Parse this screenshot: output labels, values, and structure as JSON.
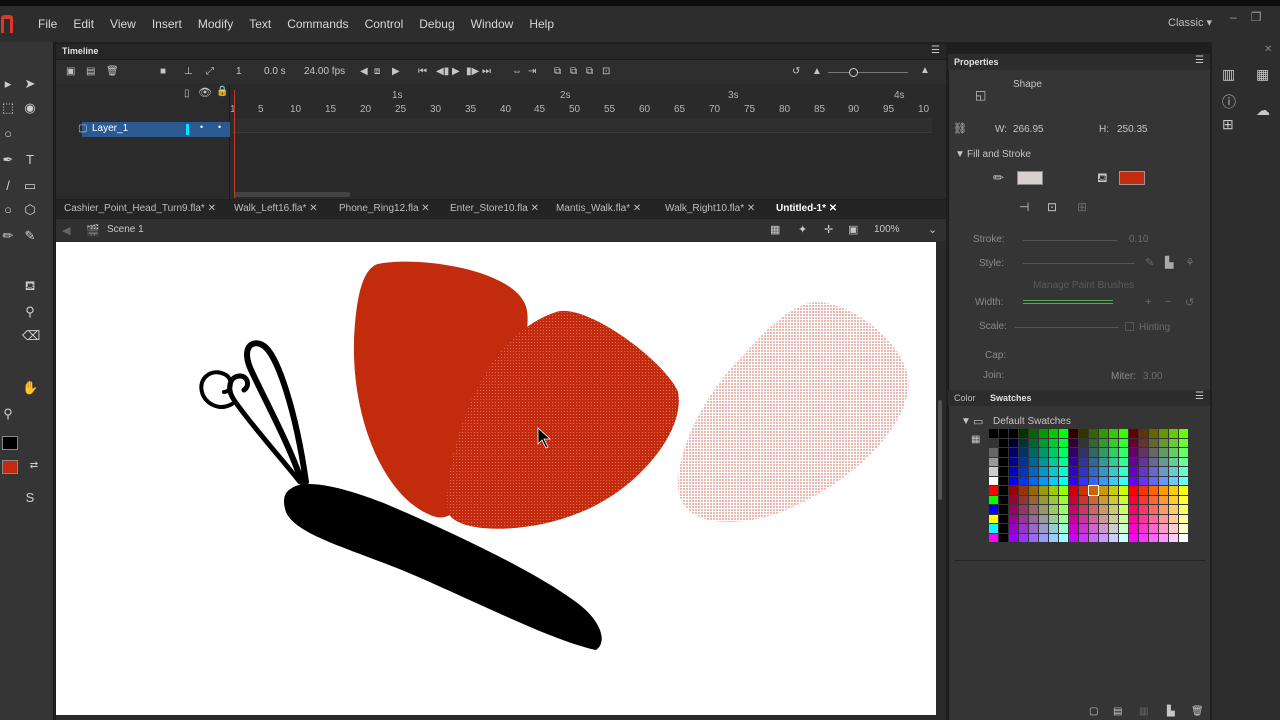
{
  "menu": [
    "File",
    "Edit",
    "View",
    "Insert",
    "Modify",
    "Text",
    "Commands",
    "Control",
    "Debug",
    "Window",
    "Help"
  ],
  "workspace": "Classic",
  "timeline": {
    "title": "Timeline",
    "frame": "1",
    "time": "0.0 s",
    "fps": "24.00 fps",
    "seconds": [
      "1s",
      "2s",
      "3s",
      "4s"
    ],
    "frame_ticks": [
      "1",
      "5",
      "10",
      "15",
      "20",
      "25",
      "30",
      "35",
      "40",
      "45",
      "50",
      "55",
      "60",
      "65",
      "70",
      "75",
      "80",
      "85",
      "90",
      "95",
      "10"
    ],
    "layer_name": "Layer_1"
  },
  "tabs": [
    "Cashier_Point_Head_Turn9.fla*",
    "Walk_Left16.fla*",
    "Phone_Ring12.fla",
    "Enter_Store10.fla",
    "Mantis_Walk.fla*",
    "Walk_Right10.fla*",
    "Untitled-1*"
  ],
  "scene": "Scene 1",
  "zoom": "100%",
  "properties": {
    "title": "Properties",
    "type": "Shape",
    "w_label": "W:",
    "w": "266.95",
    "h_label": "H:",
    "h": "250.35",
    "section": "Fill and Stroke",
    "stroke_label": "Stroke:",
    "stroke_value": "0.10",
    "style_label": "Style:",
    "manage_brushes": "Manage Paint Brushes",
    "width_label": "Width:",
    "scale_label": "Scale:",
    "hinting": "Hinting",
    "cap_label": "Cap:",
    "join_label": "Join:",
    "miter_label": "Miter:",
    "miter_value": "3.00",
    "fill_color": "#c32b0f"
  },
  "swatches": {
    "tab_color": "Color",
    "tab_swatches": "Swatches",
    "folder": "Default Swatches"
  }
}
